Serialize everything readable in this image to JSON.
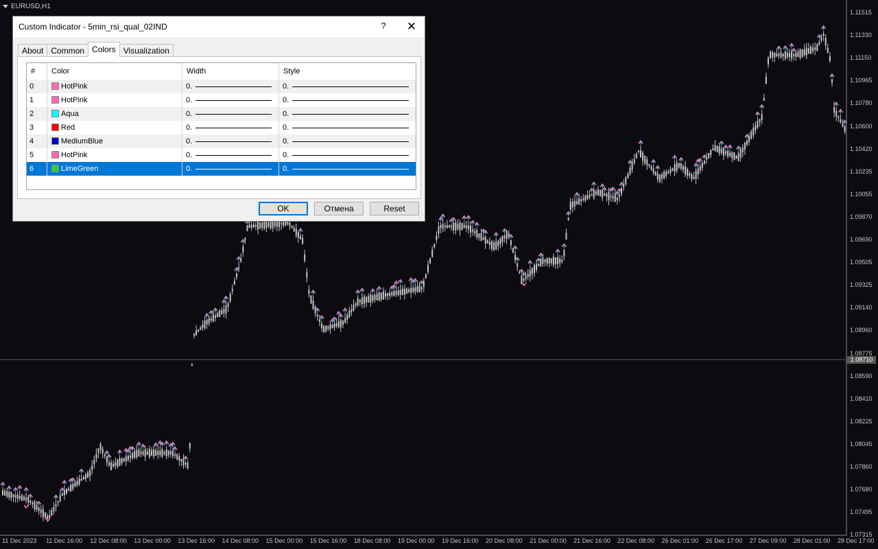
{
  "chart": {
    "symbol": "EURUSD,H1",
    "background": "#0b0b10",
    "candle_color": "#c8c8c8",
    "current_price": "1.08710",
    "price_labels": [
      "1.11515",
      "1.11330",
      "1.11150",
      "1.10965",
      "1.10780",
      "1.10600",
      "1.10420",
      "1.10235",
      "1.10055",
      "1.09870",
      "1.09690",
      "1.09505",
      "1.09325",
      "1.09140",
      "1.08960",
      "1.08775",
      "1.08590",
      "1.08410",
      "1.08225",
      "1.08045",
      "1.07860",
      "1.07680",
      "1.07495",
      "1.07315"
    ],
    "time_labels": [
      "11 Dec 2023",
      "11 Dec 16:00",
      "12 Dec 08:00",
      "13 Dec 00:00",
      "13 Dec 16:00",
      "14 Dec 08:00",
      "15 Dec 00:00",
      "15 Dec 16:00",
      "18 Dec 08:00",
      "19 Dec 00:00",
      "19 Dec 16:00",
      "20 Dec 08:00",
      "21 Dec 00:00",
      "21 Dec 16:00",
      "22 Dec 08:00",
      "26 Dec 01:00",
      "26 Dec 17:00",
      "27 Dec 09:00",
      "28 Dec 01:00",
      "28 Dec 17:00"
    ]
  },
  "dialog": {
    "title": "Custom Indicator - 5min_rsi_qual_02IND",
    "help_label": "?",
    "close_label": "✕",
    "tabs": [
      {
        "label": "About"
      },
      {
        "label": "Common"
      },
      {
        "label": "Colors",
        "active": true
      },
      {
        "label": "Visualization"
      }
    ],
    "columns": {
      "n": "#",
      "color": "Color",
      "width": "Width",
      "style": "Style"
    },
    "rows": [
      {
        "n": "0",
        "name": "HotPink",
        "hex": "#ff69b4",
        "width": "0.",
        "style": "0."
      },
      {
        "n": "1",
        "name": "HotPink",
        "hex": "#ff69b4",
        "width": "0.",
        "style": "0."
      },
      {
        "n": "2",
        "name": "Aqua",
        "hex": "#00ffff",
        "width": "0.",
        "style": "0."
      },
      {
        "n": "3",
        "name": "Red",
        "hex": "#ff0000",
        "width": "0.",
        "style": "0."
      },
      {
        "n": "4",
        "name": "MediumBlue",
        "hex": "#0000cd",
        "width": "0.",
        "style": "0."
      },
      {
        "n": "5",
        "name": "HotPink",
        "hex": "#ff69b4",
        "width": "0.",
        "style": "0."
      },
      {
        "n": "6",
        "name": "LimeGreen",
        "hex": "#32cd32",
        "width": "0.",
        "style": "0.",
        "selected": true
      }
    ],
    "ok_label": "OK",
    "cancel_label": "Отмена",
    "reset_label": "Reset",
    "selection_color": "#0078d7"
  }
}
